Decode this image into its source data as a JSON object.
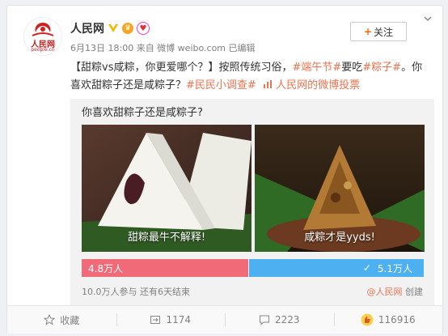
{
  "post": {
    "author": "人民网",
    "meta": "6月13日 18:00 来自 微博 weibo.com  已编辑",
    "follow_label": "关注",
    "text_part1": "【甜粽vs咸粽，你更爱哪个？】按照传统习俗，",
    "tag1": "#端午节#",
    "text_part2": "要吃",
    "tag2": "#粽子#",
    "text_part3": "。你喜欢甜粽子还是咸粽子？",
    "tag3": "#民民小调查#",
    "link_text": "人民网的微博投票"
  },
  "avatar": {
    "logo_text": "人民网",
    "logo_sub": "people.cn"
  },
  "vote": {
    "question": "你喜欢甜粽子还是咸粽子?",
    "options": [
      {
        "label": "甜粽最牛不解释!",
        "count": "4.8万人",
        "color": "#f06a78"
      },
      {
        "label": "咸粽才是yyds!",
        "count": "5.1万人",
        "color": "#4db0f0"
      }
    ],
    "footer": "10.0万人参与  还有6天结束",
    "creator": "@人民网",
    "created": "创建"
  },
  "actions": {
    "favorite": "收藏",
    "repost": "1174",
    "comment": "2223",
    "like": "116916"
  },
  "colors": {
    "accent": "#eb7350",
    "left_bar": "#f06a78",
    "right_bar": "#4db0f0"
  }
}
